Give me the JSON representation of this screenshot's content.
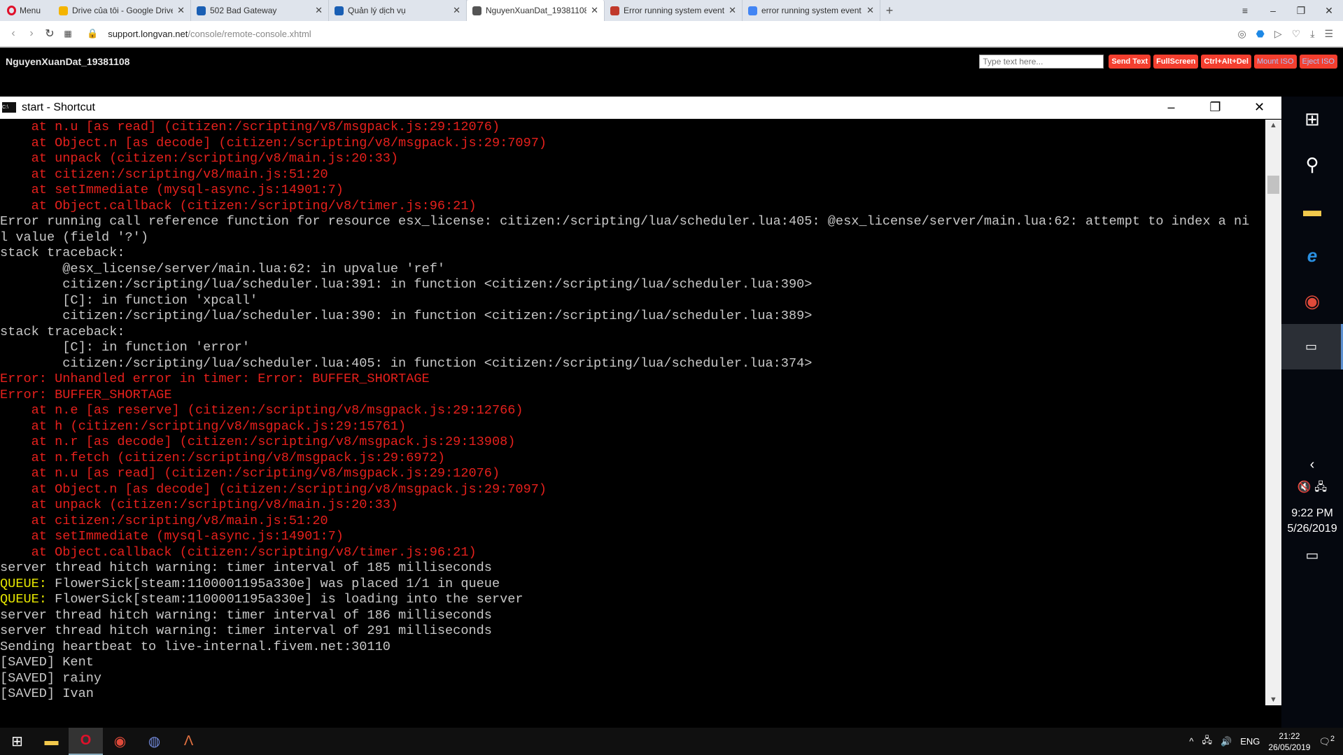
{
  "browser": {
    "menu_label": "Menu",
    "tabs": [
      {
        "label": "Drive của tôi - Google Drive",
        "color": "#f4b400"
      },
      {
        "label": "502 Bad Gateway",
        "color": "#1a5fb4"
      },
      {
        "label": "Quản lý dịch vụ",
        "color": "#1a5fb4"
      },
      {
        "label": "NguyenXuanDat_19381108",
        "color": "#555555",
        "active": true
      },
      {
        "label": "Error running system event",
        "color": "#c0392b"
      },
      {
        "label": "error running system event",
        "color": "#4285f4"
      }
    ],
    "url_host": "support.longvan.net",
    "url_path": "/console/remote-console.xhtml"
  },
  "header": {
    "title": "NguyenXuanDat_19381108",
    "input_placeholder": "Type text here...",
    "buttons": [
      "Send Text",
      "FullScreen",
      "Ctrl+Alt+Del",
      "Mount ISO",
      "Eject ISO"
    ]
  },
  "console_window": {
    "title": "start - Shortcut"
  },
  "colors": {
    "red": "#e5201c",
    "white": "#c8c8c8",
    "yellow": "#e6e600"
  },
  "console_lines": [
    {
      "t": "    at n.u [as read] (citizen:/scripting/v8/msgpack.js:29:12076)",
      "c": "red"
    },
    {
      "t": "    at Object.n [as decode] (citizen:/scripting/v8/msgpack.js:29:7097)",
      "c": "red"
    },
    {
      "t": "    at unpack (citizen:/scripting/v8/main.js:20:33)",
      "c": "red"
    },
    {
      "t": "    at citizen:/scripting/v8/main.js:51:20",
      "c": "red"
    },
    {
      "t": "    at setImmediate (mysql-async.js:14901:7)",
      "c": "red"
    },
    {
      "t": "    at Object.callback (citizen:/scripting/v8/timer.js:96:21)",
      "c": "red"
    },
    {
      "t": "Error running call reference function for resource esx_license: citizen:/scripting/lua/scheduler.lua:405: @esx_license/server/main.lua:62: attempt to index a ni",
      "c": "white"
    },
    {
      "t": "l value (field '?')",
      "c": "white"
    },
    {
      "t": "stack traceback:",
      "c": "white"
    },
    {
      "t": "        @esx_license/server/main.lua:62: in upvalue 'ref'",
      "c": "white"
    },
    {
      "t": "        citizen:/scripting/lua/scheduler.lua:391: in function <citizen:/scripting/lua/scheduler.lua:390>",
      "c": "white"
    },
    {
      "t": "        [C]: in function 'xpcall'",
      "c": "white"
    },
    {
      "t": "        citizen:/scripting/lua/scheduler.lua:390: in function <citizen:/scripting/lua/scheduler.lua:389>",
      "c": "white"
    },
    {
      "t": "stack traceback:",
      "c": "white"
    },
    {
      "t": "        [C]: in function 'error'",
      "c": "white"
    },
    {
      "t": "        citizen:/scripting/lua/scheduler.lua:405: in function <citizen:/scripting/lua/scheduler.lua:374>",
      "c": "white"
    },
    {
      "t": "Error: Unhandled error in timer: Error: BUFFER_SHORTAGE",
      "c": "red"
    },
    {
      "t": "Error: BUFFER_SHORTAGE",
      "c": "red"
    },
    {
      "t": "    at n.e [as reserve] (citizen:/scripting/v8/msgpack.js:29:12766)",
      "c": "red"
    },
    {
      "t": "    at h (citizen:/scripting/v8/msgpack.js:29:15761)",
      "c": "red"
    },
    {
      "t": "    at n.r [as decode] (citizen:/scripting/v8/msgpack.js:29:13908)",
      "c": "red"
    },
    {
      "t": "    at n.fetch (citizen:/scripting/v8/msgpack.js:29:6972)",
      "c": "red"
    },
    {
      "t": "    at n.u [as read] (citizen:/scripting/v8/msgpack.js:29:12076)",
      "c": "red"
    },
    {
      "t": "    at Object.n [as decode] (citizen:/scripting/v8/msgpack.js:29:7097)",
      "c": "red"
    },
    {
      "t": "    at unpack (citizen:/scripting/v8/main.js:20:33)",
      "c": "red"
    },
    {
      "t": "    at citizen:/scripting/v8/main.js:51:20",
      "c": "red"
    },
    {
      "t": "    at setImmediate (mysql-async.js:14901:7)",
      "c": "red"
    },
    {
      "t": "    at Object.callback (citizen:/scripting/v8/timer.js:96:21)",
      "c": "red"
    },
    {
      "t": "server thread hitch warning: timer interval of 185 milliseconds",
      "c": "white"
    },
    {
      "p": "QUEUE:",
      "t": " FlowerSick[steam:1100001195a330e] was placed 1/1 in queue",
      "c": "white"
    },
    {
      "p": "QUEUE:",
      "t": " FlowerSick[steam:1100001195a330e] is loading into the server",
      "c": "white"
    },
    {
      "t": "server thread hitch warning: timer interval of 186 milliseconds",
      "c": "white"
    },
    {
      "t": "server thread hitch warning: timer interval of 291 milliseconds",
      "c": "white"
    },
    {
      "t": "Sending heartbeat to live-internal.fivem.net:30110",
      "c": "white"
    },
    {
      "t": "[SAVED] Kent",
      "c": "white"
    },
    {
      "t": "[SAVED] rainy",
      "c": "white"
    },
    {
      "t": "[SAVED] Ivan",
      "c": "white"
    }
  ],
  "remote_desktop": {
    "time": "9:22 PM",
    "date": "5/26/2019"
  },
  "taskbar": {
    "lang": "ENG",
    "time": "21:22",
    "date": "26/05/2019",
    "notifications": "2"
  }
}
